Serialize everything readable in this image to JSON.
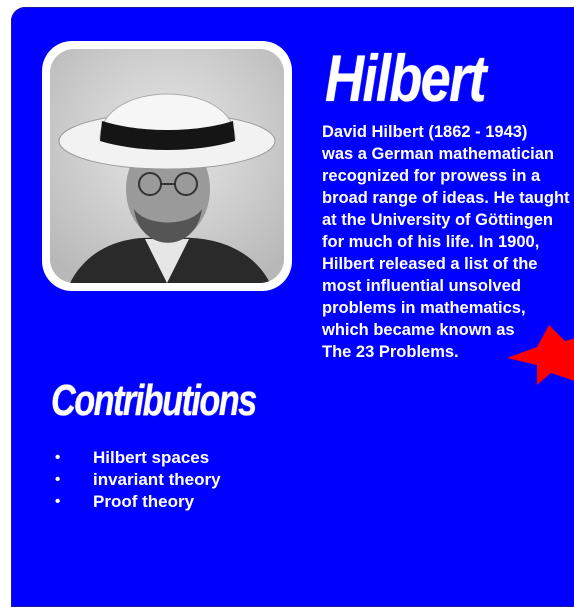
{
  "profile": {
    "name": "Hilbert",
    "bio_lines": [
      "David Hilbert (1862 - 1943)",
      "was a German mathematician",
      "recognized for prowess in a",
      "broad range of ideas. He taught",
      "at the University of Göttingen",
      "for much of his life. In 1900,",
      "Hilbert released a list of the",
      "most influential unsolved",
      "problems in mathematics,",
      "which became known as",
      "The 23 Problems."
    ]
  },
  "contributions": {
    "heading": "Contributions",
    "bullet": "•",
    "items": [
      "Hilbert spaces",
      "invariant theory",
      "Proof theory"
    ]
  },
  "colors": {
    "background": "#0000ff",
    "text": "#ffffff",
    "accent": "#ff0000"
  }
}
